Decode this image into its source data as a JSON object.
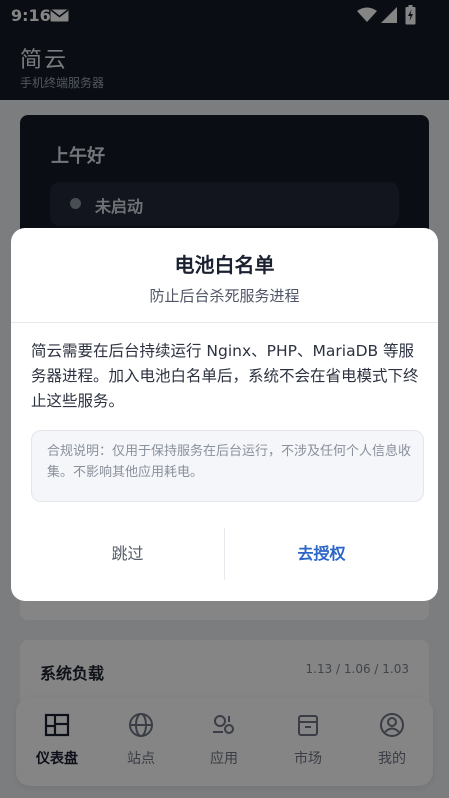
{
  "status_bar": {
    "time": "9:16"
  },
  "app": {
    "title": "简云",
    "subtitle": "手机终端服务器"
  },
  "dashboard": {
    "greeting": "上午好",
    "server_status": "未启动",
    "system_load": {
      "title": "系统负载",
      "values": "1.13 / 1.06 / 1.03"
    }
  },
  "bottom_nav": {
    "items": [
      {
        "label": "仪表盘",
        "icon": "dashboard-icon",
        "active": true
      },
      {
        "label": "站点",
        "icon": "globe-icon",
        "active": false
      },
      {
        "label": "应用",
        "icon": "apps-icon",
        "active": false
      },
      {
        "label": "市场",
        "icon": "store-icon",
        "active": false
      },
      {
        "label": "我的",
        "icon": "user-icon",
        "active": false
      }
    ]
  },
  "dialog": {
    "title": "电池白名单",
    "subtitle": "防止后台杀死服务进程",
    "body": "简云需要在后台持续运行 Nginx、PHP、MariaDB 等服务器进程。加入电池白名单后，系统不会在省电模式下终止这些服务。",
    "note": "合规说明：仅用于保持服务在后台运行，不涉及任何个人信息收集。不影响其他应用耗电。",
    "skip_label": "跳过",
    "grant_label": "去授权"
  },
  "colors": {
    "header_bg": "#151b28",
    "accent": "#2c65c8",
    "scrim": "rgba(0,0,0,0.48)"
  }
}
